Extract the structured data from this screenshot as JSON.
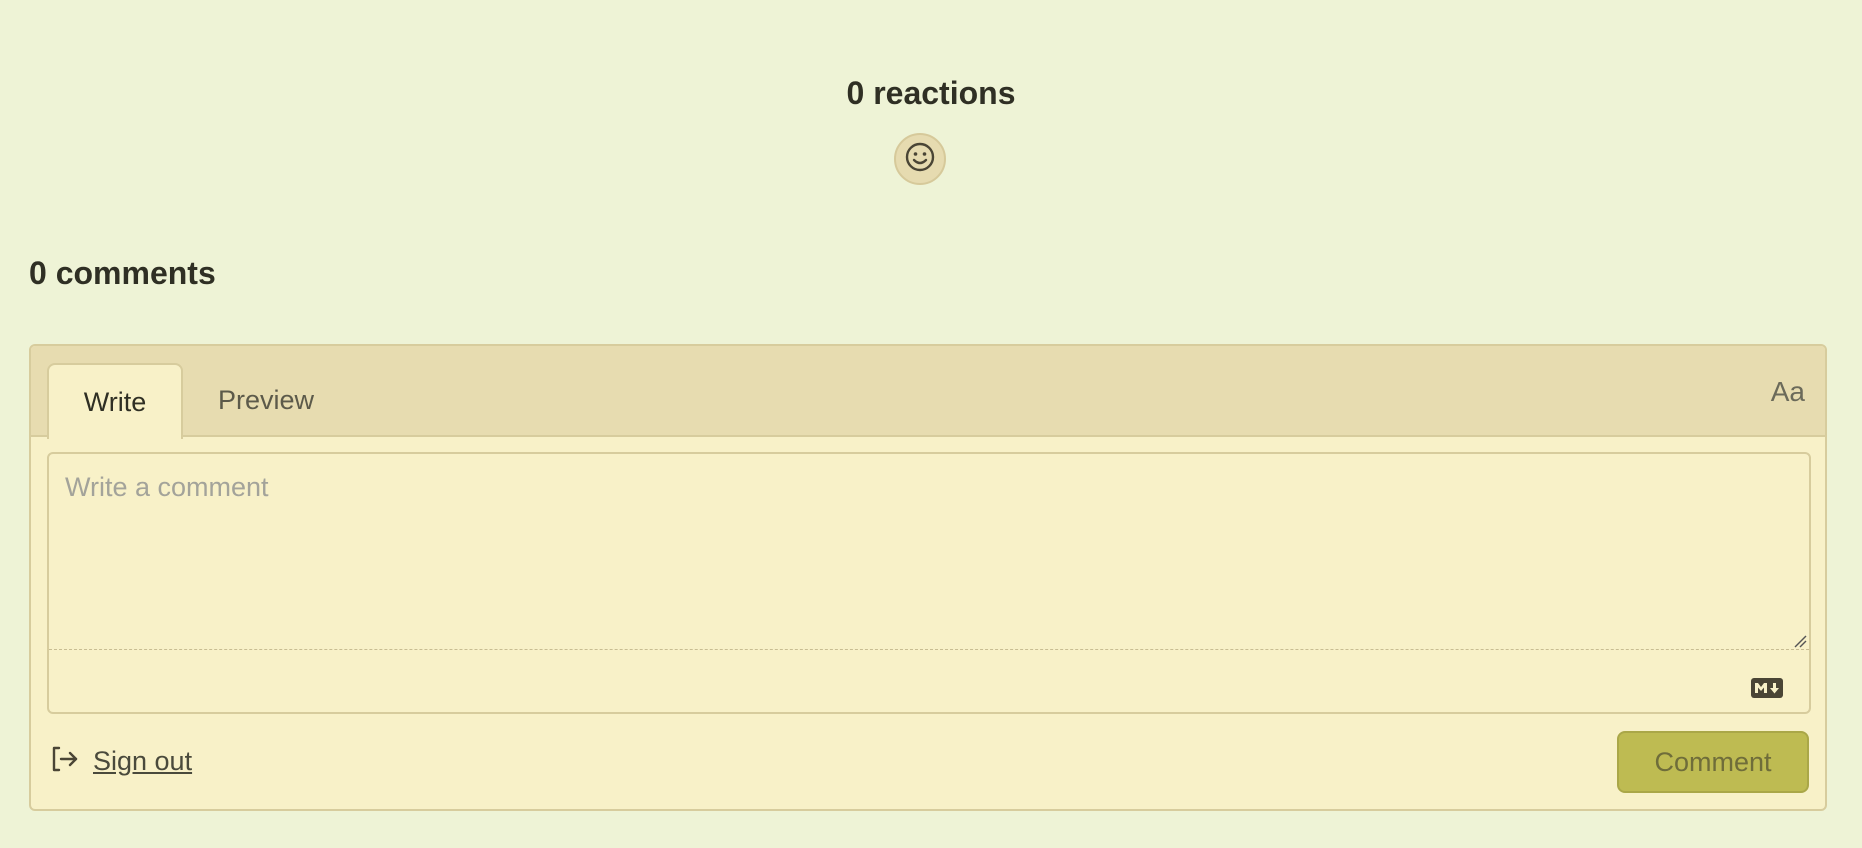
{
  "reactions": {
    "title": "0 reactions",
    "add_reaction_icon": "smiley-icon"
  },
  "comments": {
    "count_title": "0 comments"
  },
  "editor": {
    "tabs": [
      {
        "label": "Write",
        "active": true
      },
      {
        "label": "Preview",
        "active": false
      }
    ],
    "font_toggle_label": "Aa",
    "placeholder": "Write a comment",
    "value": "",
    "markdown_icon": "markdown-icon"
  },
  "footer": {
    "signout_icon": "sign-out-icon",
    "signout_label": "Sign out",
    "submit_label": "Comment"
  },
  "colors": {
    "background": "#eef3d6",
    "panel": "#f8f1c8",
    "tabbar": "#e7dcb0",
    "button": "#bebb52"
  }
}
